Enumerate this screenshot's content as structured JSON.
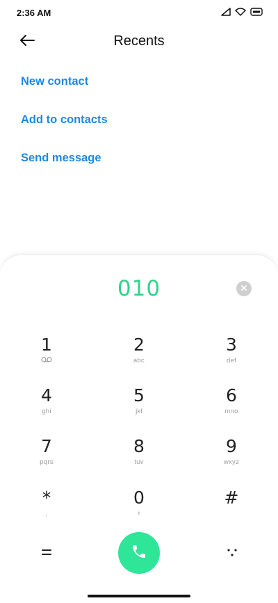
{
  "status_bar": {
    "time": "2:36 AM",
    "icons": [
      "signal-icon",
      "wifi-icon",
      "battery-icon"
    ]
  },
  "header": {
    "title": "Recents",
    "back_icon": "arrow-left-icon"
  },
  "actions": [
    {
      "label": "New contact"
    },
    {
      "label": "Add to contacts"
    },
    {
      "label": "Send message"
    }
  ],
  "dialer": {
    "number": "010",
    "clear_icon": "clear-icon",
    "keys": [
      {
        "digit": "1",
        "letters": "voicemail-icon"
      },
      {
        "digit": "2",
        "letters": "abc"
      },
      {
        "digit": "3",
        "letters": "def"
      },
      {
        "digit": "4",
        "letters": "ghi"
      },
      {
        "digit": "5",
        "letters": "jkl"
      },
      {
        "digit": "6",
        "letters": "mno"
      },
      {
        "digit": "7",
        "letters": "pqrs"
      },
      {
        "digit": "8",
        "letters": "tuv"
      },
      {
        "digit": "9",
        "letters": "wxyz"
      },
      {
        "digit": "*",
        "letters": ","
      },
      {
        "digit": "0",
        "letters": "+"
      },
      {
        "digit": "#",
        "letters": ""
      }
    ],
    "bottom": {
      "left_icon": "menu-equals-icon",
      "call_icon": "phone-icon",
      "right_icon": "dots-icon"
    }
  },
  "colors": {
    "accent": "#1e88e5",
    "number": "#2ed48a",
    "call": "#2ee598"
  }
}
